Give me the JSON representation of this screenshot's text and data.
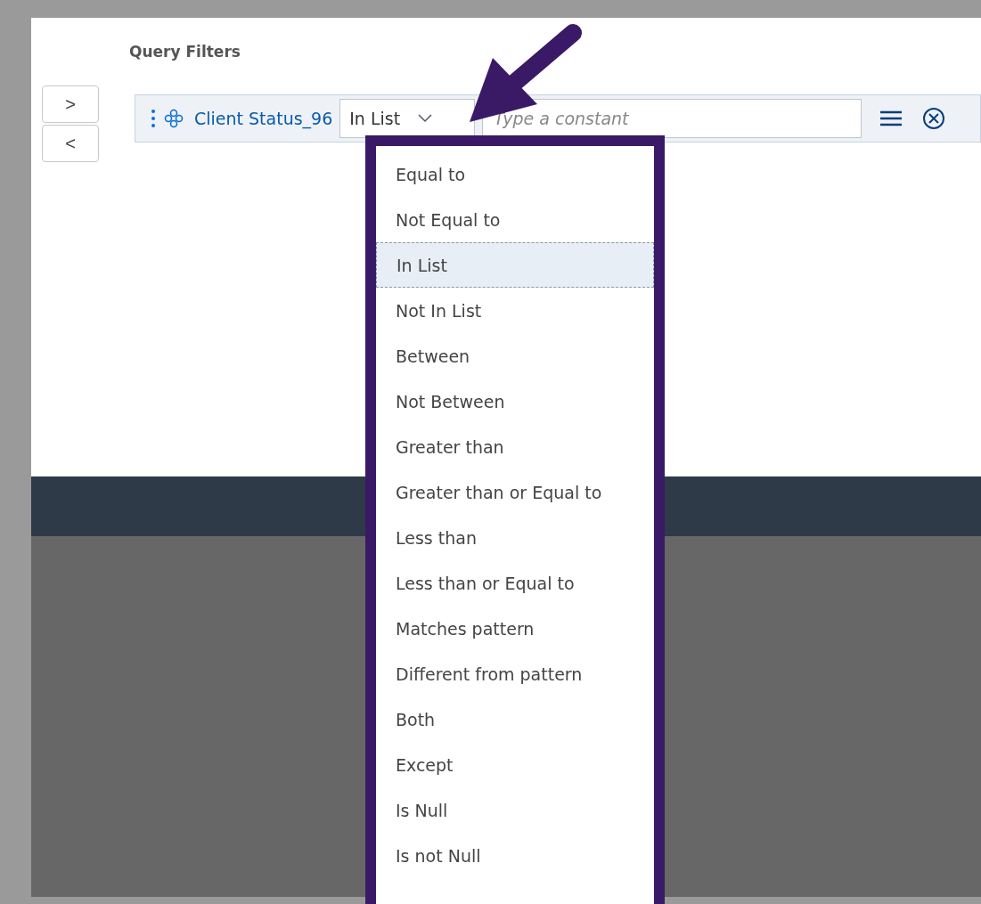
{
  "panel": {
    "title": "Query Filters"
  },
  "nav_buttons": [
    {
      "label": ">"
    },
    {
      "label": "<"
    }
  ],
  "filter": {
    "object": "Client Status_96",
    "operator": "In List",
    "placeholder": "Type a constant",
    "expanded": true
  },
  "dropdown": {
    "options": [
      {
        "label": "Equal to",
        "selected": false
      },
      {
        "label": "Not Equal to",
        "selected": false
      },
      {
        "label": "In List",
        "selected": true
      },
      {
        "label": "Not In List",
        "selected": false
      },
      {
        "label": "Between",
        "selected": false
      },
      {
        "label": "Not Between",
        "selected": false
      },
      {
        "label": "Greater than",
        "selected": false
      },
      {
        "label": "Greater than or Equal to",
        "selected": false
      },
      {
        "label": "Less than",
        "selected": false
      },
      {
        "label": "Less than or Equal to",
        "selected": false
      },
      {
        "label": "Matches pattern",
        "selected": false
      },
      {
        "label": "Different from pattern",
        "selected": false
      },
      {
        "label": "Both",
        "selected": false
      },
      {
        "label": "Except",
        "selected": false
      },
      {
        "label": "Is Null",
        "selected": false
      },
      {
        "label": "Is not Null",
        "selected": false
      }
    ]
  }
}
